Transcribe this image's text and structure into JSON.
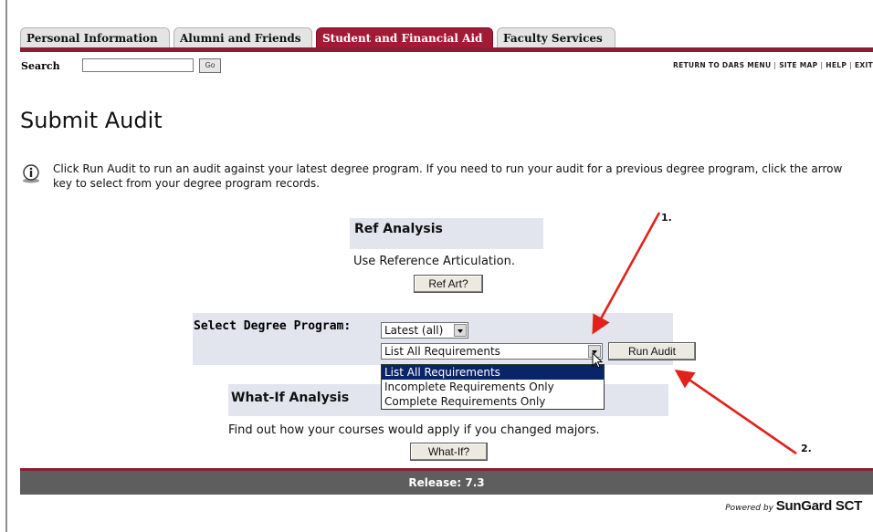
{
  "tabs": [
    {
      "label": "Personal Information",
      "active": false
    },
    {
      "label": "Alumni and Friends",
      "active": false
    },
    {
      "label": "Student and Financial Aid",
      "active": true
    },
    {
      "label": "Faculty Services",
      "active": false
    }
  ],
  "search": {
    "label": "Search",
    "value": "",
    "go_label": "Go"
  },
  "top_links": [
    "RETURN TO DARS MENU",
    "SITE MAP",
    "HELP",
    "EXIT"
  ],
  "page_title": "Submit Audit",
  "info_text": "Click Run Audit to run an audit against your latest degree program. If you need to run your audit for a previous degree program, click the arrow key to select from your degree program records.",
  "ref_analysis": {
    "title": "Ref Analysis",
    "description": "Use Reference Articulation.",
    "button": "Ref Art?"
  },
  "degree_program": {
    "label": "Select Degree Program:",
    "selected": "Latest (all)",
    "requirements_selected": "List All Requirements",
    "requirements_options": [
      "List All Requirements",
      "Incomplete Requirements Only",
      "Complete Requirements Only"
    ],
    "run_button": "Run Audit"
  },
  "what_if": {
    "title": "What-If Analysis",
    "description": "Find out how your courses would apply if you changed majors.",
    "button": "What-If?"
  },
  "footer": {
    "release": "Release: 7.3",
    "powered_prefix": "Powered by",
    "powered_brand": "SunGard SCT"
  },
  "annotations": {
    "one": "1.",
    "two": "2."
  },
  "colors": {
    "tab_active": "#a31a35",
    "tab_line": "#8c1c32",
    "release_bar": "#5e5e5e",
    "arrow": "#e0221b"
  }
}
